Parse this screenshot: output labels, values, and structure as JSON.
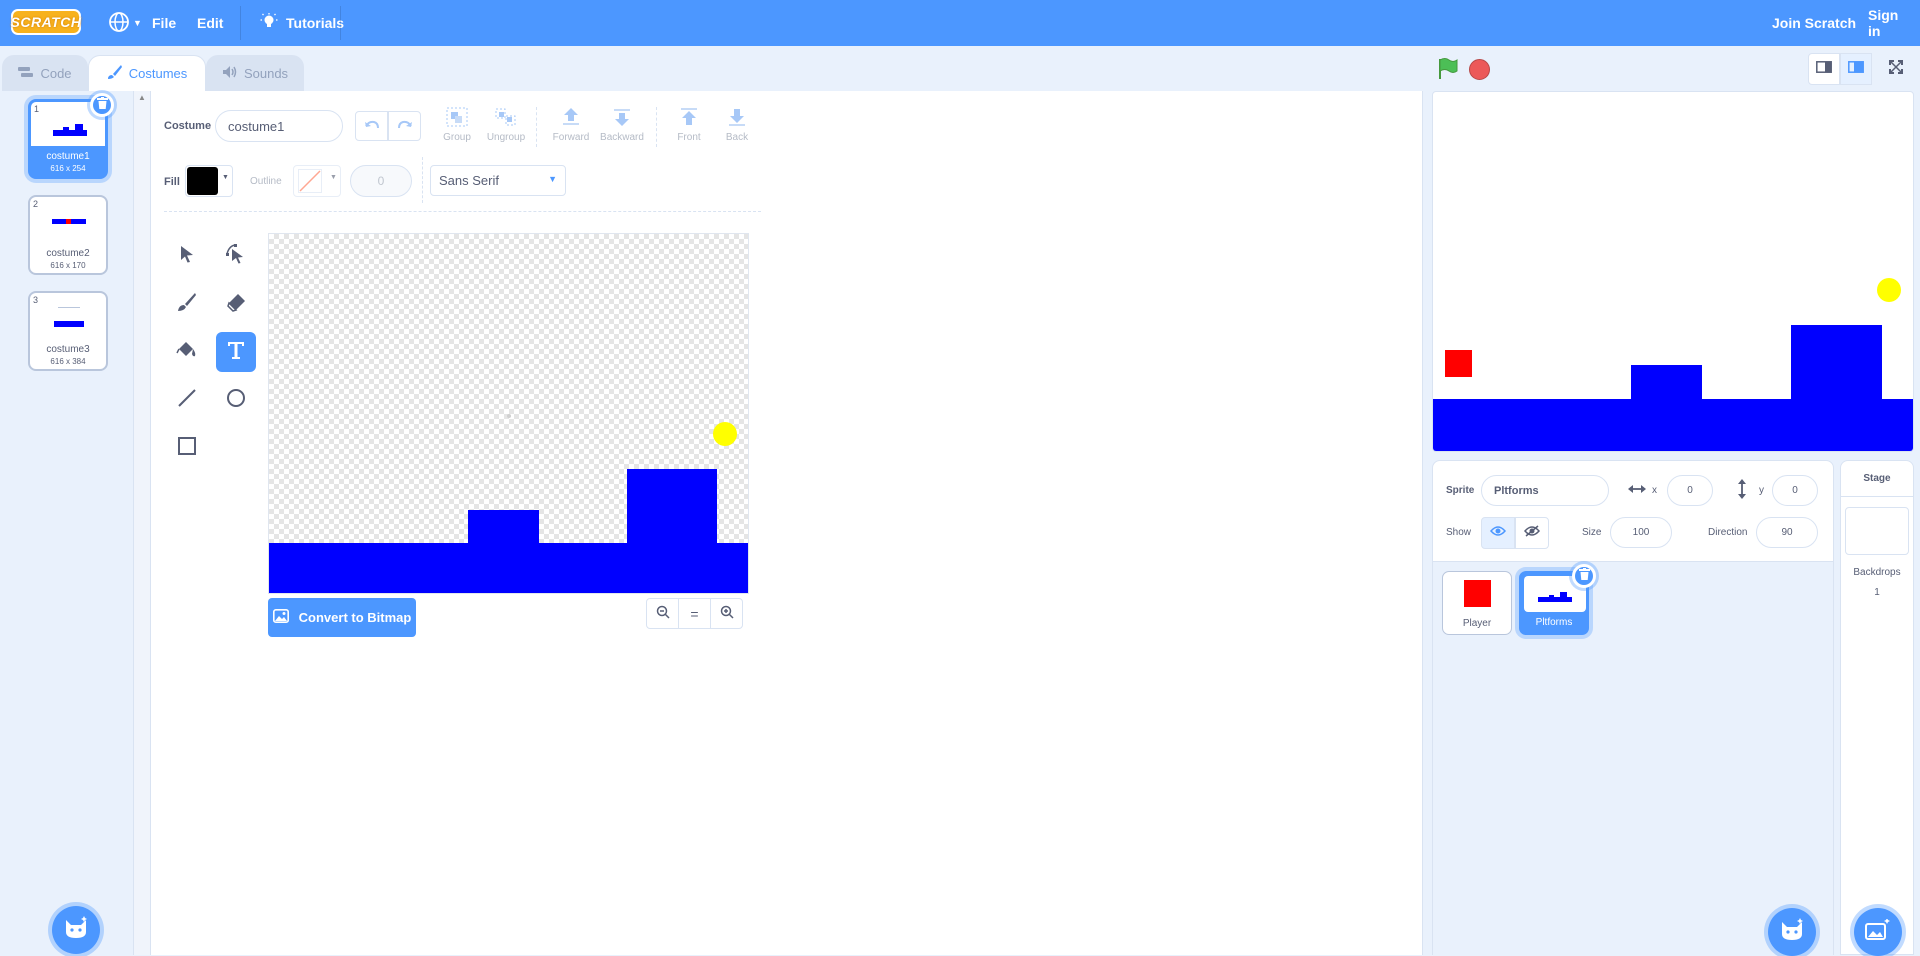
{
  "menubar": {
    "logo": "SCRATCH",
    "file": "File",
    "edit": "Edit",
    "tutorials": "Tutorials",
    "join": "Join Scratch",
    "signin": "Sign in",
    "bg_color": "#4c97ff"
  },
  "tabs": {
    "code": "Code",
    "costumes": "Costumes",
    "sounds": "Sounds",
    "active": "Costumes"
  },
  "costumes": [
    {
      "num": "1",
      "name": "costume1",
      "size": "616 x 254",
      "selected": true
    },
    {
      "num": "2",
      "name": "costume2",
      "size": "616 x 170",
      "selected": false
    },
    {
      "num": "3",
      "name": "costume3",
      "size": "616 x 384",
      "selected": false
    }
  ],
  "editor": {
    "costume_label": "Costume",
    "costume_name": "costume1",
    "group": "Group",
    "ungroup": "Ungroup",
    "forward": "Forward",
    "backward": "Backward",
    "front": "Front",
    "back": "Back",
    "fill_label": "Fill",
    "fill_color": "#000000",
    "outline_label": "Outline",
    "outline_width": "0",
    "font": "Sans Serif",
    "selected_tool": "text",
    "convert_bitmap": "Convert to Bitmap",
    "zoom_reset": "="
  },
  "sprite_info": {
    "sprite_label": "Sprite",
    "sprite_name": "Pltforms",
    "x_label": "x",
    "x_value": "0",
    "y_label": "y",
    "y_value": "0",
    "show_label": "Show",
    "size_label": "Size",
    "size_value": "100",
    "direction_label": "Direction",
    "direction_value": "90"
  },
  "sprites": [
    {
      "name": "Player",
      "selected": false
    },
    {
      "name": "Pltforms",
      "selected": true
    }
  ],
  "stage_panel": {
    "title": "Stage",
    "backdrops_label": "Backdrops",
    "backdrops_count": "1"
  },
  "colors": {
    "accent": "#4c97ff",
    "platform": "#0000ff",
    "player": "#ff0000",
    "sun": "#ffff00"
  }
}
